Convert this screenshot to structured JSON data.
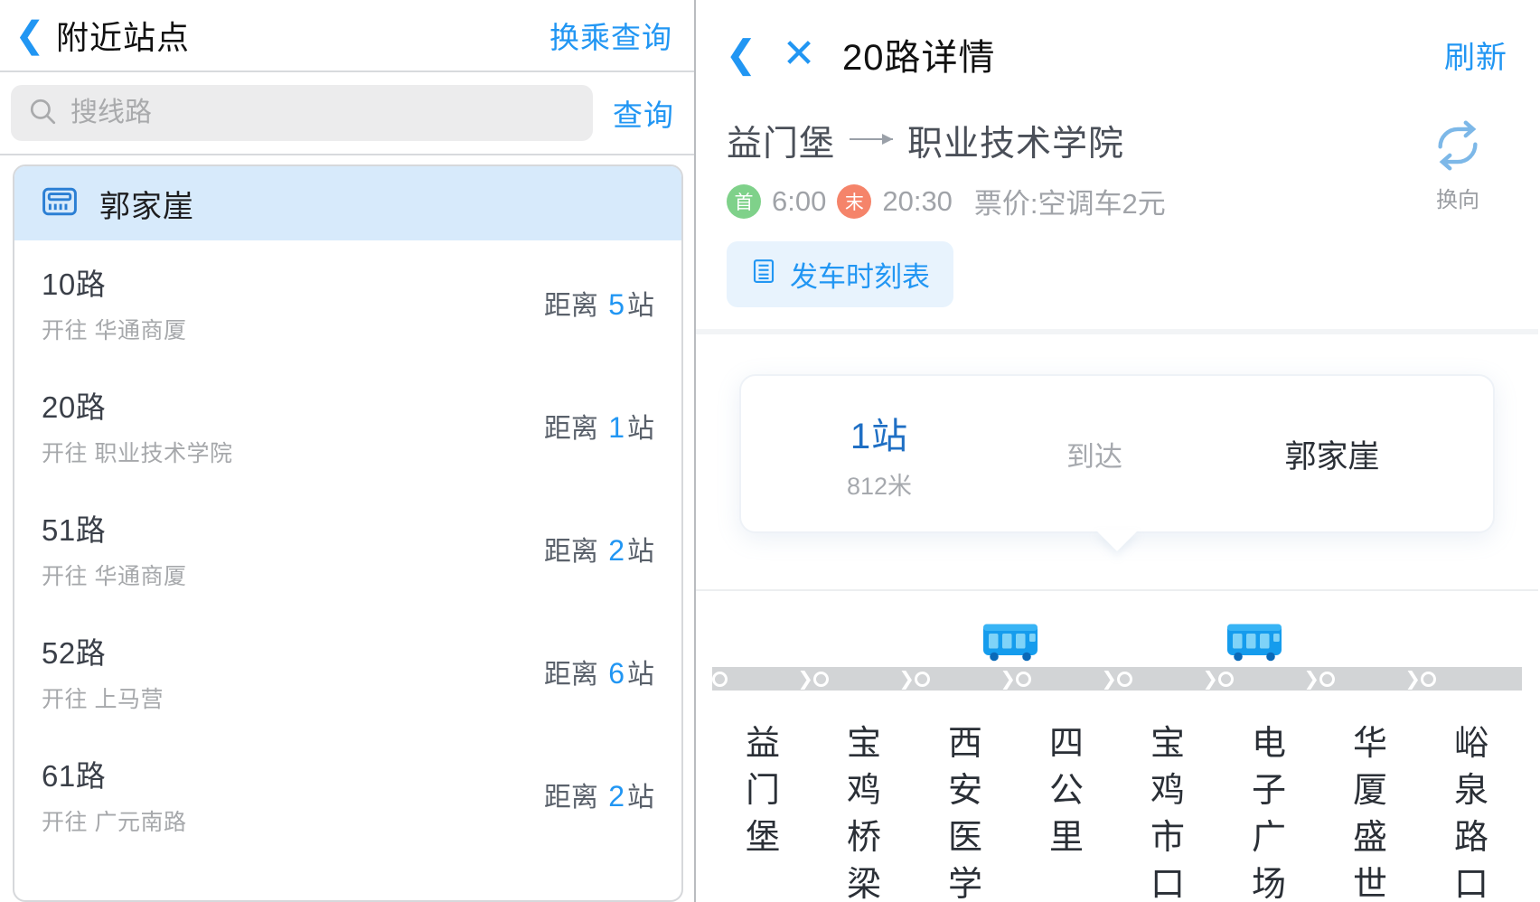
{
  "left": {
    "header": {
      "back_icon": "chevron-left-icon",
      "title": "附近站点",
      "action_label": "换乘查询"
    },
    "search": {
      "icon": "search-icon",
      "placeholder": "搜线路",
      "value": "",
      "go_label": "查询"
    },
    "station": {
      "icon": "bus-stop-icon",
      "name": "郭家崖"
    },
    "routes": [
      {
        "no": "10路",
        "direction": "开往 华通商厦",
        "dist_prefix": "距离",
        "dist_num": "5",
        "dist_suffix": "站"
      },
      {
        "no": "20路",
        "direction": "开往 职业技术学院",
        "dist_prefix": "距离",
        "dist_num": "1",
        "dist_suffix": "站"
      },
      {
        "no": "51路",
        "direction": "开往 华通商厦",
        "dist_prefix": "距离",
        "dist_num": "2",
        "dist_suffix": "站"
      },
      {
        "no": "52路",
        "direction": "开往 上马营",
        "dist_prefix": "距离",
        "dist_num": "6",
        "dist_suffix": "站"
      },
      {
        "no": "61路",
        "direction": "开往 广元南路",
        "dist_prefix": "距离",
        "dist_num": "2",
        "dist_suffix": "站"
      }
    ]
  },
  "right": {
    "header": {
      "back_icon": "chevron-left-icon",
      "close_icon": "close-icon",
      "title": "20路详情",
      "refresh_label": "刷新"
    },
    "route": {
      "origin": "益门堡",
      "destination": "职业技术学院",
      "first_badge": "首",
      "first_time": "6:00",
      "last_badge": "末",
      "last_time": "20:30",
      "fare": "票价:空调车2元",
      "swap_icon": "swap-direction-icon",
      "swap_label": "换向",
      "timetable_icon": "timetable-icon",
      "timetable_label": "发车时刻表"
    },
    "arrival": {
      "stops": "1站",
      "distance": "812米",
      "status": "到达",
      "station": "郭家崖"
    },
    "track": {
      "buses": [
        {
          "name": "bus-icon",
          "position_pct": 36.5
        },
        {
          "name": "bus-icon",
          "position_pct": 65.0
        }
      ],
      "stations": [
        {
          "chars": [
            "益",
            "门",
            "堡"
          ]
        },
        {
          "chars": [
            "宝",
            "鸡",
            "桥",
            "梁"
          ]
        },
        {
          "chars": [
            "西",
            "安",
            "医",
            "学"
          ]
        },
        {
          "chars": [
            "四",
            "公",
            "里"
          ]
        },
        {
          "chars": [
            "宝",
            "鸡",
            "市",
            "口"
          ]
        },
        {
          "chars": [
            "电",
            "子",
            "广",
            "场"
          ]
        },
        {
          "chars": [
            "华",
            "厦",
            "盛",
            "世"
          ]
        },
        {
          "chars": [
            "峪",
            "泉",
            "路",
            "口"
          ]
        }
      ]
    }
  },
  "colors": {
    "accent": "#2196f3",
    "station_head_bg": "#d7eafb",
    "first_badge": "#7fd18a",
    "last_badge": "#f5846a",
    "bus": "#159ced",
    "track": "#d2d4d6"
  }
}
